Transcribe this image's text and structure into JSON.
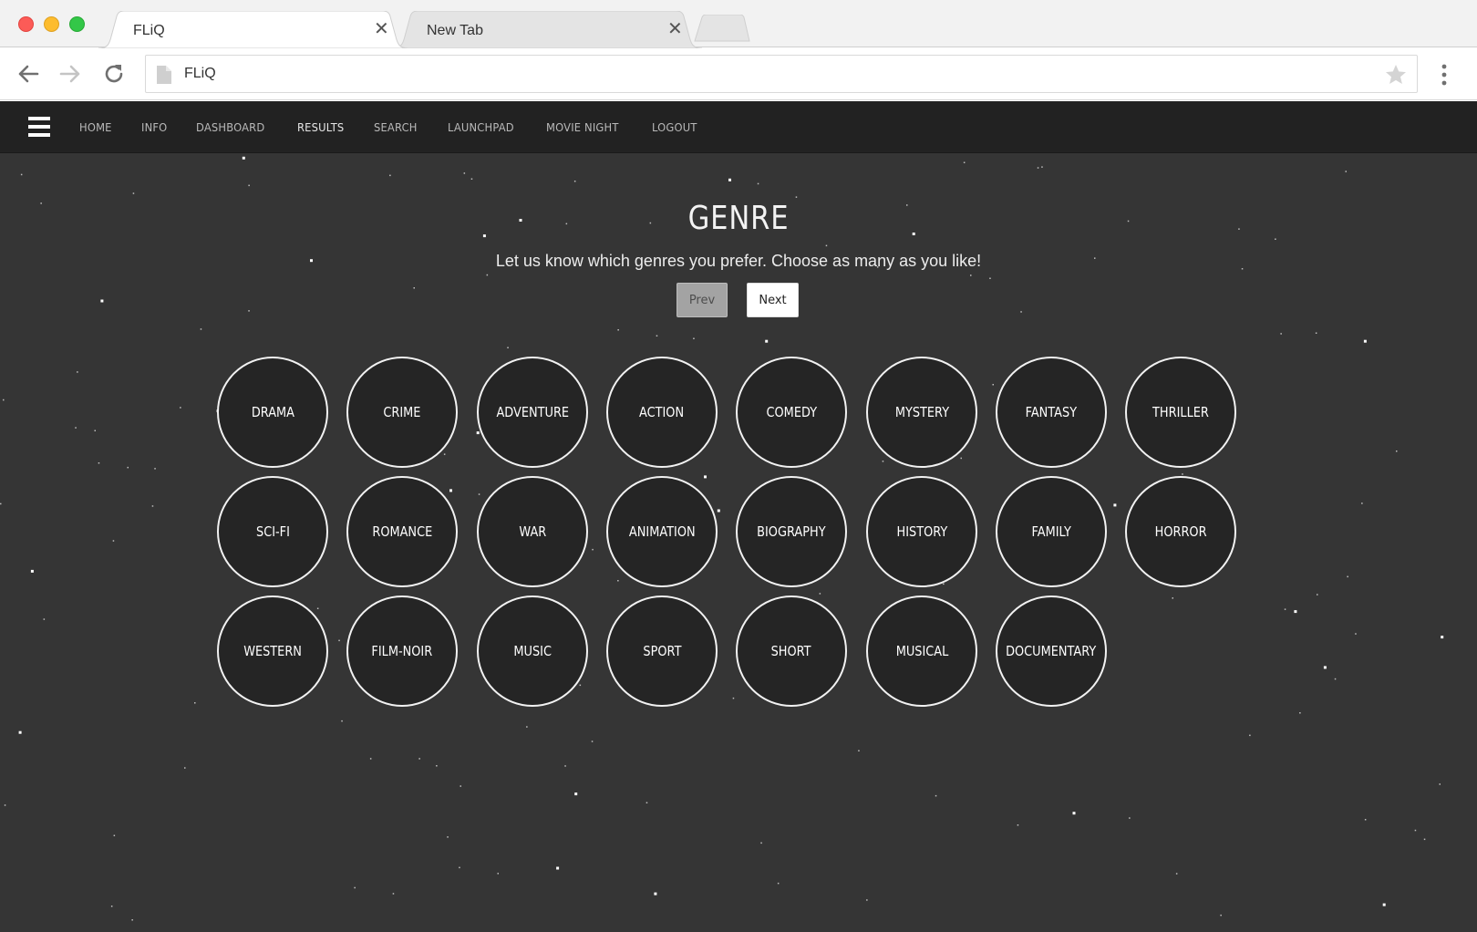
{
  "browser": {
    "tabs": [
      {
        "title": "FLiQ",
        "close": "✕",
        "active": true
      },
      {
        "title": "New Tab",
        "close": "✕",
        "active": false
      }
    ],
    "address": "FLiQ"
  },
  "nav": {
    "links": [
      "HOME",
      "INFO",
      "DASHBOARD",
      "RESULTS",
      "SEARCH",
      "LAUNCHPAD",
      "MOVIE NIGHT",
      "LOGOUT"
    ],
    "current": "RESULTS"
  },
  "main": {
    "heading": "GENRE",
    "subtitle": "Let us know which genres you prefer. Choose as many as you like!",
    "prev_label": "Prev",
    "next_label": "Next"
  },
  "genres": [
    "DRAMA",
    "CRIME",
    "ADVENTURE",
    "ACTION",
    "COMEDY",
    "MYSTERY",
    "FANTASY",
    "THRILLER",
    "SCI-FI",
    "ROMANCE",
    "WAR",
    "ANIMATION",
    "BIOGRAPHY",
    "HISTORY",
    "FAMILY",
    "HORROR",
    "WESTERN",
    "FILM-NOIR",
    "MUSIC",
    "SPORT",
    "SHORT",
    "MUSICAL",
    "DOCUMENTARY"
  ],
  "colors": {
    "background": "#353535",
    "navbar": "#222222",
    "circle_fill": "#252525",
    "circle_border": "#f2f2f2"
  }
}
